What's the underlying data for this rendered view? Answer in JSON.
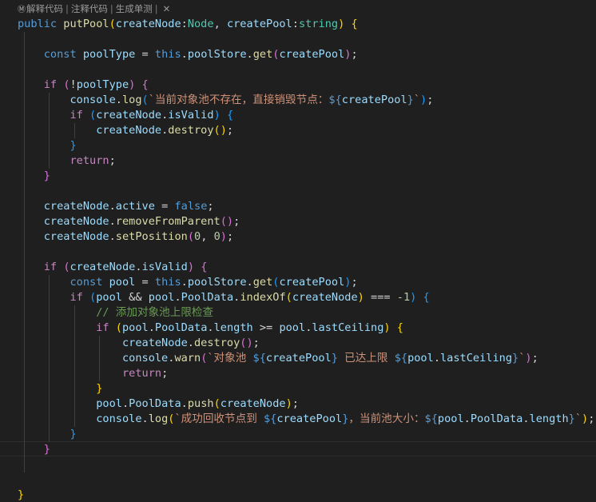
{
  "codelens": {
    "icon": "Ⓜ",
    "items": [
      "解释代码",
      "注释代码",
      "生成单测"
    ],
    "separator": "|",
    "close": "✕"
  },
  "code_lines": [
    [
      [
        "public",
        "kw"
      ],
      [
        " ",
        ""
      ],
      [
        "putPool",
        "fn"
      ],
      [
        "(",
        "b1"
      ],
      [
        "createNode",
        "var"
      ],
      [
        ":",
        "punc"
      ],
      [
        "Node",
        "type"
      ],
      [
        ", ",
        "punc"
      ],
      [
        "createPool",
        "var"
      ],
      [
        ":",
        "punc"
      ],
      [
        "string",
        "type"
      ],
      [
        ")",
        "b1"
      ],
      [
        " ",
        ""
      ],
      [
        "{",
        "b1"
      ]
    ],
    [],
    [
      [
        "    ",
        ""
      ],
      [
        "const",
        "kw"
      ],
      [
        " ",
        ""
      ],
      [
        "poolType",
        "var"
      ],
      [
        " = ",
        "op"
      ],
      [
        "this",
        "kw"
      ],
      [
        ".",
        "punc"
      ],
      [
        "poolStore",
        "var"
      ],
      [
        ".",
        "punc"
      ],
      [
        "get",
        "fn"
      ],
      [
        "(",
        "b2"
      ],
      [
        "createPool",
        "var"
      ],
      [
        ")",
        "b2"
      ],
      [
        ";",
        "punc"
      ]
    ],
    [],
    [
      [
        "    ",
        ""
      ],
      [
        "if",
        "ctrl"
      ],
      [
        " ",
        ""
      ],
      [
        "(",
        "b2"
      ],
      [
        "!",
        "op"
      ],
      [
        "poolType",
        "var"
      ],
      [
        ")",
        "b2"
      ],
      [
        " ",
        ""
      ],
      [
        "{",
        "b2"
      ]
    ],
    [
      [
        "        ",
        ""
      ],
      [
        "console",
        "var"
      ],
      [
        ".",
        "punc"
      ],
      [
        "log",
        "fn"
      ],
      [
        "(",
        "b3"
      ],
      [
        "`当前对象池不存在，直接销毁节点：",
        "str"
      ],
      [
        "${",
        "tpl"
      ],
      [
        "createPool",
        "var"
      ],
      [
        "}",
        "tpl"
      ],
      [
        "`",
        "str"
      ],
      [
        ")",
        "b3"
      ],
      [
        ";",
        "punc"
      ]
    ],
    [
      [
        "        ",
        ""
      ],
      [
        "if",
        "ctrl"
      ],
      [
        " ",
        ""
      ],
      [
        "(",
        "b3"
      ],
      [
        "createNode",
        "var"
      ],
      [
        ".",
        "punc"
      ],
      [
        "isValid",
        "var"
      ],
      [
        ")",
        "b3"
      ],
      [
        " ",
        ""
      ],
      [
        "{",
        "b3"
      ]
    ],
    [
      [
        "            ",
        ""
      ],
      [
        "createNode",
        "var"
      ],
      [
        ".",
        "punc"
      ],
      [
        "destroy",
        "fn"
      ],
      [
        "(",
        "b1"
      ],
      [
        ")",
        "b1"
      ],
      [
        ";",
        "punc"
      ]
    ],
    [
      [
        "        ",
        ""
      ],
      [
        "}",
        "b3"
      ]
    ],
    [
      [
        "        ",
        ""
      ],
      [
        "return",
        "ctrl"
      ],
      [
        ";",
        "punc"
      ]
    ],
    [
      [
        "    ",
        ""
      ],
      [
        "}",
        "b2"
      ]
    ],
    [],
    [
      [
        "    ",
        ""
      ],
      [
        "createNode",
        "var"
      ],
      [
        ".",
        "punc"
      ],
      [
        "active",
        "var"
      ],
      [
        " = ",
        "op"
      ],
      [
        "false",
        "kw"
      ],
      [
        ";",
        "punc"
      ]
    ],
    [
      [
        "    ",
        ""
      ],
      [
        "createNode",
        "var"
      ],
      [
        ".",
        "punc"
      ],
      [
        "removeFromParent",
        "fn"
      ],
      [
        "(",
        "b2"
      ],
      [
        ")",
        "b2"
      ],
      [
        ";",
        "punc"
      ]
    ],
    [
      [
        "    ",
        ""
      ],
      [
        "createNode",
        "var"
      ],
      [
        ".",
        "punc"
      ],
      [
        "setPosition",
        "fn"
      ],
      [
        "(",
        "b2"
      ],
      [
        "0",
        "num"
      ],
      [
        ", ",
        "punc"
      ],
      [
        "0",
        "num"
      ],
      [
        ")",
        "b2"
      ],
      [
        ";",
        "punc"
      ]
    ],
    [],
    [
      [
        "    ",
        ""
      ],
      [
        "if",
        "ctrl"
      ],
      [
        " ",
        ""
      ],
      [
        "(",
        "b2"
      ],
      [
        "createNode",
        "var"
      ],
      [
        ".",
        "punc"
      ],
      [
        "isValid",
        "var"
      ],
      [
        ")",
        "b2"
      ],
      [
        " ",
        ""
      ],
      [
        "{",
        "b2"
      ]
    ],
    [
      [
        "        ",
        ""
      ],
      [
        "const",
        "kw"
      ],
      [
        " ",
        ""
      ],
      [
        "pool",
        "var"
      ],
      [
        " = ",
        "op"
      ],
      [
        "this",
        "kw"
      ],
      [
        ".",
        "punc"
      ],
      [
        "poolStore",
        "var"
      ],
      [
        ".",
        "punc"
      ],
      [
        "get",
        "fn"
      ],
      [
        "(",
        "b3"
      ],
      [
        "createPool",
        "var"
      ],
      [
        ")",
        "b3"
      ],
      [
        ";",
        "punc"
      ]
    ],
    [
      [
        "        ",
        ""
      ],
      [
        "if",
        "ctrl"
      ],
      [
        " ",
        ""
      ],
      [
        "(",
        "b3"
      ],
      [
        "pool",
        "var"
      ],
      [
        " && ",
        "op"
      ],
      [
        "pool",
        "var"
      ],
      [
        ".",
        "punc"
      ],
      [
        "PoolData",
        "var"
      ],
      [
        ".",
        "punc"
      ],
      [
        "indexOf",
        "fn"
      ],
      [
        "(",
        "b1"
      ],
      [
        "createNode",
        "var"
      ],
      [
        ")",
        "b1"
      ],
      [
        " === ",
        "op"
      ],
      [
        "-1",
        "num"
      ],
      [
        ")",
        "b3"
      ],
      [
        " ",
        ""
      ],
      [
        "{",
        "b3"
      ]
    ],
    [
      [
        "            ",
        ""
      ],
      [
        "// 添加对象池上限检查",
        "cmt"
      ]
    ],
    [
      [
        "            ",
        ""
      ],
      [
        "if",
        "ctrl"
      ],
      [
        " ",
        ""
      ],
      [
        "(",
        "b1"
      ],
      [
        "pool",
        "var"
      ],
      [
        ".",
        "punc"
      ],
      [
        "PoolData",
        "var"
      ],
      [
        ".",
        "punc"
      ],
      [
        "length",
        "var"
      ],
      [
        " >= ",
        "op"
      ],
      [
        "pool",
        "var"
      ],
      [
        ".",
        "punc"
      ],
      [
        "lastCeiling",
        "var"
      ],
      [
        ")",
        "b1"
      ],
      [
        " ",
        ""
      ],
      [
        "{",
        "b1"
      ]
    ],
    [
      [
        "                ",
        ""
      ],
      [
        "createNode",
        "var"
      ],
      [
        ".",
        "punc"
      ],
      [
        "destroy",
        "fn"
      ],
      [
        "(",
        "b2"
      ],
      [
        ")",
        "b2"
      ],
      [
        ";",
        "punc"
      ]
    ],
    [
      [
        "                ",
        ""
      ],
      [
        "console",
        "var"
      ],
      [
        ".",
        "punc"
      ],
      [
        "warn",
        "fn"
      ],
      [
        "(",
        "b2"
      ],
      [
        "`对象池 ",
        "str"
      ],
      [
        "${",
        "tpl"
      ],
      [
        "createPool",
        "var"
      ],
      [
        "}",
        "tpl"
      ],
      [
        " 已达上限 ",
        "str"
      ],
      [
        "${",
        "tpl"
      ],
      [
        "pool",
        "var"
      ],
      [
        ".",
        "punc"
      ],
      [
        "lastCeiling",
        "var"
      ],
      [
        "}",
        "tpl"
      ],
      [
        "`",
        "str"
      ],
      [
        ")",
        "b2"
      ],
      [
        ";",
        "punc"
      ]
    ],
    [
      [
        "                ",
        ""
      ],
      [
        "return",
        "ctrl"
      ],
      [
        ";",
        "punc"
      ]
    ],
    [
      [
        "            ",
        ""
      ],
      [
        "}",
        "b1"
      ]
    ],
    [
      [
        "            ",
        ""
      ],
      [
        "pool",
        "var"
      ],
      [
        ".",
        "punc"
      ],
      [
        "PoolData",
        "var"
      ],
      [
        ".",
        "punc"
      ],
      [
        "push",
        "fn"
      ],
      [
        "(",
        "b1"
      ],
      [
        "createNode",
        "var"
      ],
      [
        ")",
        "b1"
      ],
      [
        ";",
        "punc"
      ]
    ],
    [
      [
        "            ",
        ""
      ],
      [
        "console",
        "var"
      ],
      [
        ".",
        "punc"
      ],
      [
        "log",
        "fn"
      ],
      [
        "(",
        "b1"
      ],
      [
        "`成功回收节点到 ",
        "str"
      ],
      [
        "${",
        "tpl"
      ],
      [
        "createPool",
        "var"
      ],
      [
        "}",
        "tpl"
      ],
      [
        "，当前池大小：",
        "str"
      ],
      [
        "${",
        "tpl"
      ],
      [
        "pool",
        "var"
      ],
      [
        ".",
        "punc"
      ],
      [
        "PoolData",
        "var"
      ],
      [
        ".",
        "punc"
      ],
      [
        "length",
        "var"
      ],
      [
        "}",
        "tpl"
      ],
      [
        "`",
        "str"
      ],
      [
        ")",
        "b1"
      ],
      [
        ";",
        "punc"
      ]
    ],
    [
      [
        "        ",
        ""
      ],
      [
        "}",
        "b3"
      ]
    ],
    [
      [
        "    ",
        ""
      ],
      [
        "}",
        "b2"
      ]
    ],
    [],
    [],
    [
      [
        "}",
        "b1"
      ]
    ]
  ]
}
